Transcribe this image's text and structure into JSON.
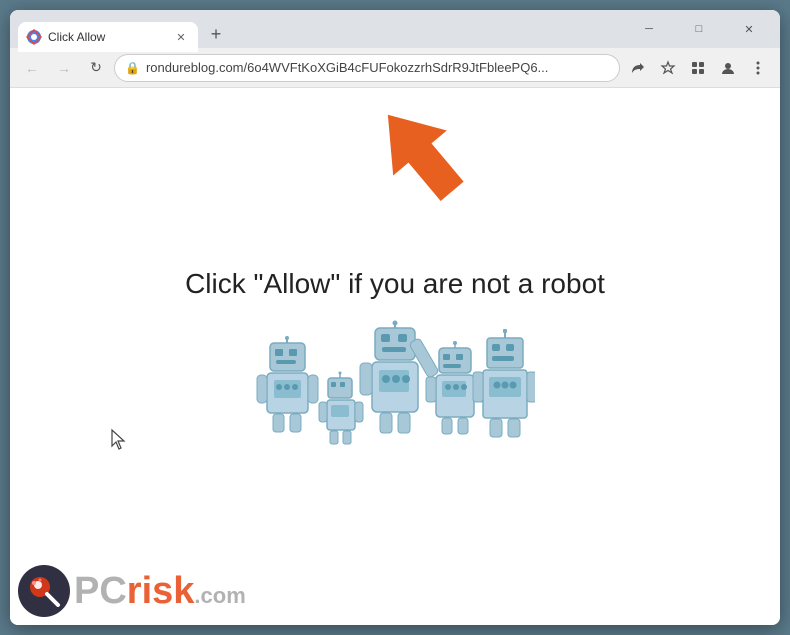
{
  "window": {
    "title": "Click Allow",
    "tab_title": "Click Allow",
    "url": "rondureblog.com/6o4WVFtKoXGiB4cFUFokozzrhSdrR9JtFbleePQ6...",
    "url_full": "rondureblog.com/6o4WVFtKoXGiB4cFUFokozzrhSdrR9JtFbleePQ6..."
  },
  "nav": {
    "back_label": "←",
    "forward_label": "→",
    "reload_label": "↻",
    "new_tab_label": "+"
  },
  "page": {
    "main_text": "Click \"Allow\"   if you are not   a robot"
  },
  "window_controls": {
    "minimize": "─",
    "maximize": "□",
    "close": "✕"
  }
}
